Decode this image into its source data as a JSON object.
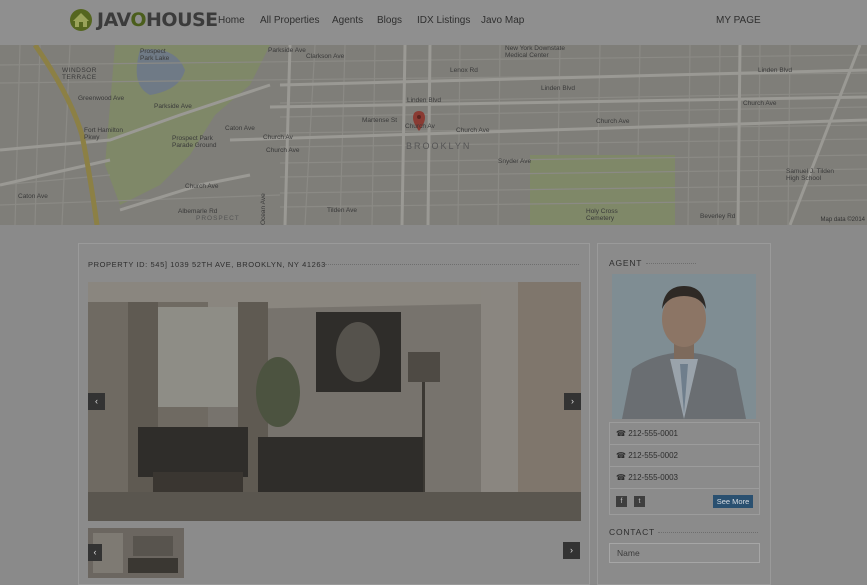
{
  "header": {
    "logo_text_left": "JAV",
    "logo_text_o": "O",
    "logo_text_right": "HOUSE",
    "nav": [
      "Home",
      "All Properties",
      "Agents",
      "Blogs",
      "IDX Listings",
      "Javo Map"
    ],
    "my_page": "MY PAGE"
  },
  "map": {
    "labels": {
      "prospect_park": "Prospect\nPark Lake",
      "windsor_terrace": "WINDSOR\nTERRACE",
      "fort_hamilton": "Fort Hamilton\nPkwy",
      "prospect_park_parade": "Prospect Park\nParade Ground",
      "brooklyn": "BROOKLYN",
      "ny_downstate": "New York Downstate\nMedical Center",
      "holy_cross": "Holy Cross\nCemetery",
      "samuel_tilden": "Samuel J. Tilden\nHigh School",
      "church_av_station": "Church Av",
      "church_av": "Church Ave",
      "linden": "Linden Blvd",
      "clarkson": "Clarkson Ave",
      "parkside": "Parkside Ave",
      "caton": "Caton Ave",
      "snyder": "Snyder Ave",
      "tilden": "Tilden Ave",
      "beverley": "Beverley Rd",
      "martense": "Martense St",
      "lenox": "Lenox Rd",
      "prospect_expy": "Prospect Expy",
      "ocean_ave": "Ocean Ave",
      "flatbush_ave": "Flatbush Ave",
      "rogers_ave": "Rogers Ave",
      "nostrand_ave": "Nostrand Ave",
      "new_york_ave": "New York Ave",
      "utica_ave": "Utica Ave",
      "kings_hwy": "Kings Hwy",
      "ralph_ave": "Ralph Av",
      "bedford_ave": "Bedford Ave",
      "albemarle": "Albemarle Rd",
      "mcdonald": "McDonald Ave",
      "greenwood": "Greenwood Ave",
      "prospect": "PROSPECT"
    },
    "credit": "Map data ©2014"
  },
  "property": {
    "id_line": "PROPERTY ID: 545] 1039 52TH AVE, BROOKLYN, NY 41263"
  },
  "agent": {
    "title": "AGENT",
    "phones": [
      "212-555-0001",
      "212-555-0002",
      "212-555-0003"
    ],
    "see_more": "See More"
  },
  "contact": {
    "title": "CONTACT",
    "name_placeholder": "Name"
  },
  "colors": {
    "accent_green": "#4b5e1c",
    "button_blue": "#2a5070",
    "pin_red": "#c0392b"
  }
}
